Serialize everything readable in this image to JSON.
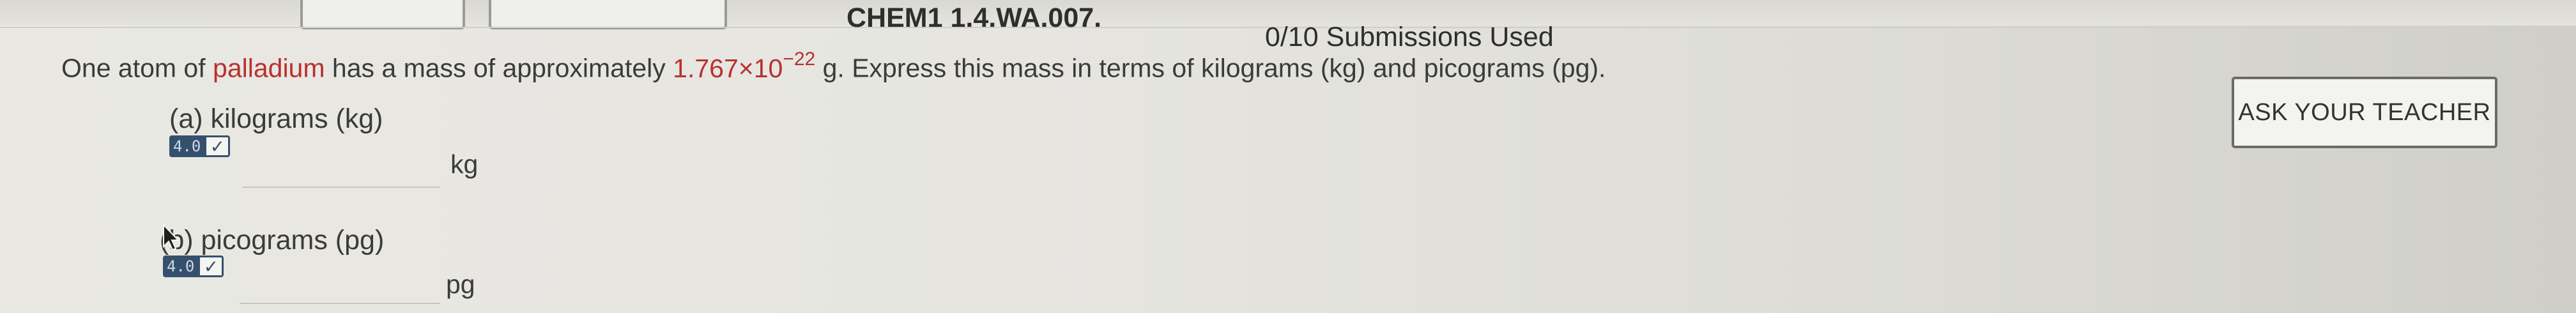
{
  "header": {
    "assignment_id": "CHEM1 1.4.WA.007.",
    "submissions": "0/10 Submissions Used"
  },
  "question": {
    "prefix": "One atom of ",
    "element": "palladium",
    "middle": " has a mass of approximately ",
    "mass_mantissa": "1.767",
    "mass_times": "×10",
    "mass_exponent": "−22",
    "suffix": " g. Express this mass in terms of kilograms (kg) and picograms (pg)."
  },
  "ask_teacher_label": "ASK YOUR TEACHER",
  "parts": [
    {
      "label": "(a) kilograms (kg)",
      "badge_num": "4.0",
      "unit": "kg",
      "value": ""
    },
    {
      "label": "(b) picograms (pg)",
      "badge_num": "4.0",
      "unit": "pg",
      "value": ""
    }
  ],
  "colors": {
    "accent_red": "#b8312f",
    "badge_blue": "#35506d"
  },
  "icons": {
    "badge_check": "check-icon",
    "cursor": "mouse-cursor-icon"
  }
}
